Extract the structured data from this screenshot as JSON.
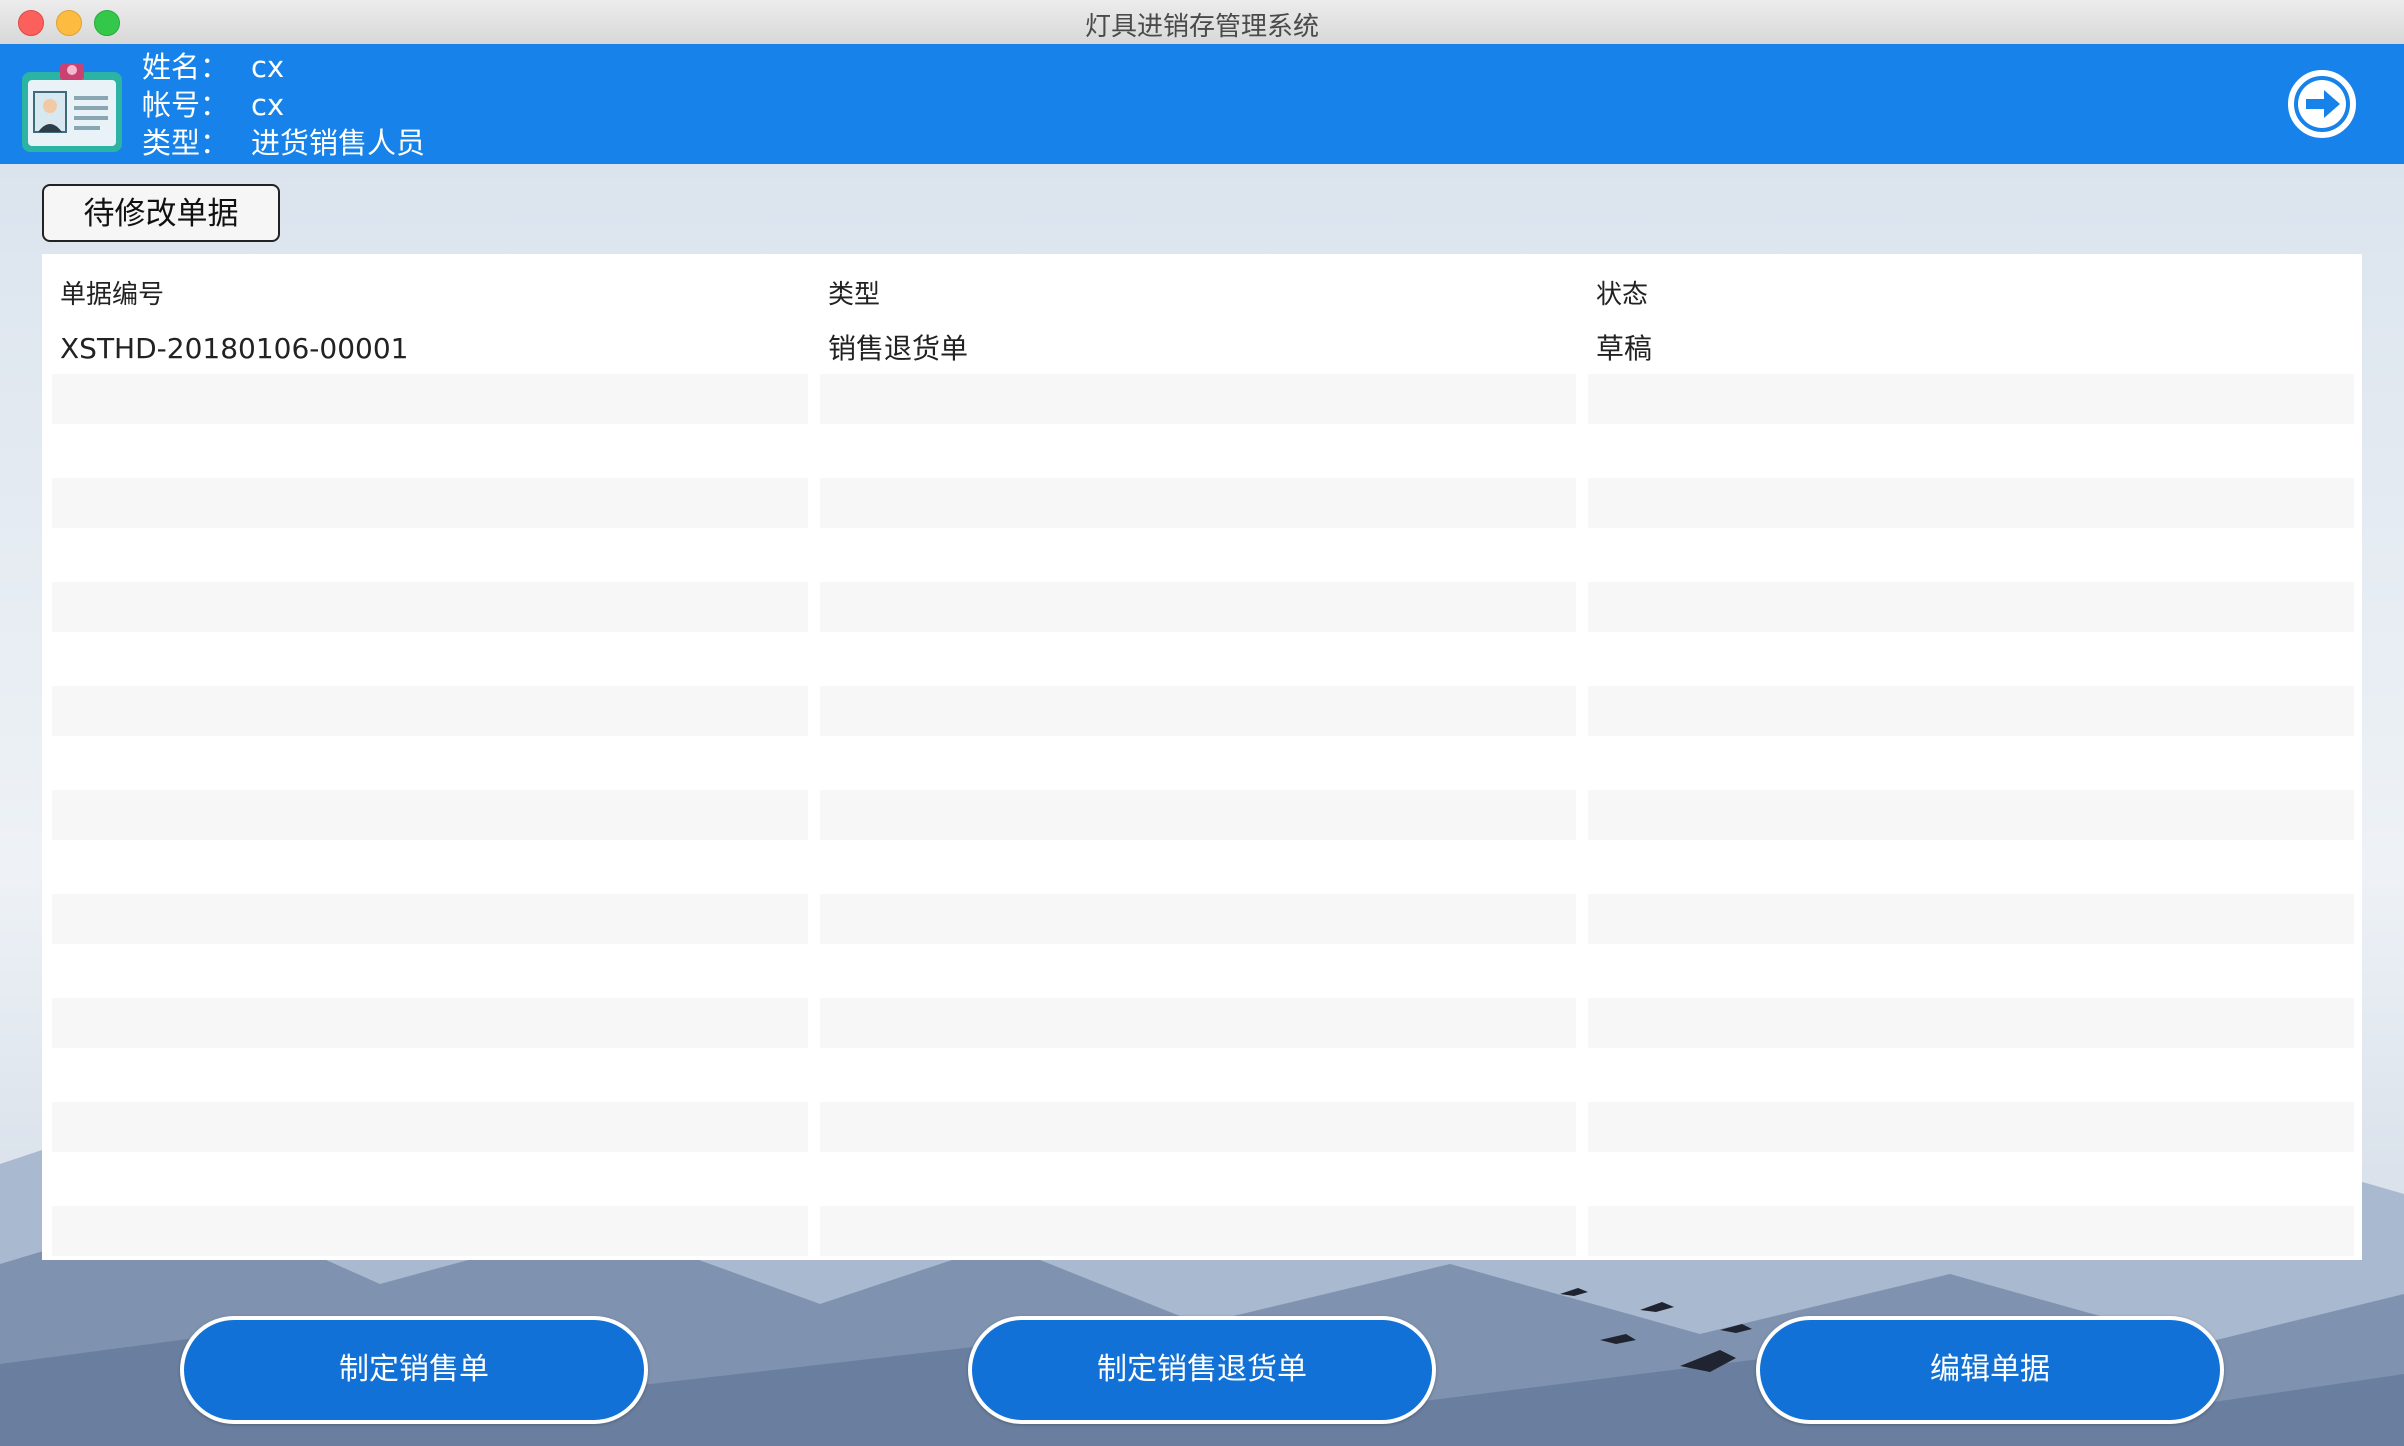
{
  "window": {
    "title": "灯具进销存管理系统"
  },
  "user": {
    "name_label": "姓名：",
    "name_value": "cx",
    "account_label": "帐号：",
    "account_value": "cx",
    "type_label": "类型：",
    "type_value": "进货销售人员"
  },
  "toolbar": {
    "pending_label": "待修改单据"
  },
  "table": {
    "headers": [
      "单据编号",
      "类型",
      "状态"
    ],
    "rows": [
      [
        "XSTHD-20180106-00001",
        "销售退货单",
        "草稿"
      ]
    ]
  },
  "actions": {
    "create_sale": "制定销售单",
    "create_return": "制定销售退货单",
    "edit": "编辑单据"
  },
  "colors": {
    "header_blue": "#1782ea",
    "button_blue": "#1171d6",
    "row_stripe": "#f7f7f7"
  },
  "icons": {
    "badge": "id-badge-icon",
    "logout": "arrow-circle-right-icon"
  }
}
